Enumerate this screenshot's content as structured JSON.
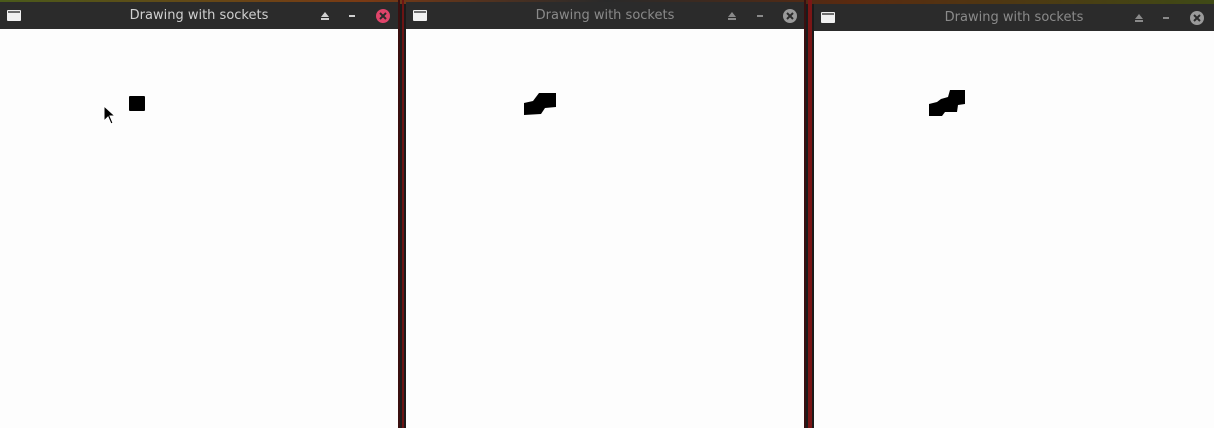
{
  "windows": [
    {
      "title": "Drawing with sockets",
      "icons": [
        "window-menu-icon",
        "keep-above-icon",
        "minimize-icon",
        "close-icon"
      ],
      "close_color": "#e0446a"
    },
    {
      "title": "Drawing with sockets",
      "icons": [
        "window-menu-icon",
        "keep-above-icon",
        "minimize-icon",
        "close-icon"
      ],
      "close_color": "#9a9a9a"
    },
    {
      "title": "Drawing with sockets",
      "icons": [
        "window-menu-icon",
        "keep-above-icon",
        "minimize-icon",
        "close-icon"
      ],
      "close_color": "#9a9a9a"
    }
  ],
  "colors": {
    "titlebar": "#2b2b2b",
    "canvas": "#fdfdfd",
    "stroke": "#000000",
    "active_close": "#e0446a"
  }
}
